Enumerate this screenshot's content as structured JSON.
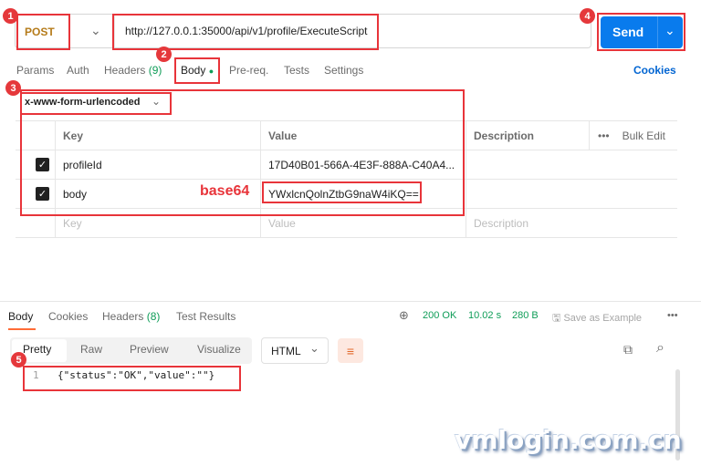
{
  "request": {
    "method": "POST",
    "url": "http://127.0.0.1:35000/api/v1/profile/ExecuteScript",
    "send_label": "Send"
  },
  "request_tabs": {
    "params": "Params",
    "auth": "Auth",
    "headers": "Headers",
    "headers_count": "(9)",
    "body": "Body",
    "prereq": "Pre-req.",
    "tests": "Tests",
    "settings": "Settings",
    "cookies": "Cookies"
  },
  "body_type": "x-www-form-urlencoded",
  "table": {
    "headers": {
      "key": "Key",
      "value": "Value",
      "description": "Description",
      "bulk_edit": "Bulk Edit"
    },
    "rows": [
      {
        "checked": true,
        "key": "profileId",
        "value": "17D40B01-566A-4E3F-888A-C40A4...",
        "description": ""
      },
      {
        "checked": true,
        "key": "body",
        "value": "YWxlcnQolnZtbG9naW4iKQ==",
        "description": ""
      }
    ],
    "placeholder": {
      "key": "Key",
      "value": "Value",
      "description": "Description"
    }
  },
  "annotation_label": "base64",
  "badges": [
    "1",
    "2",
    "3",
    "4",
    "5"
  ],
  "response": {
    "tabs": {
      "body": "Body",
      "cookies": "Cookies",
      "headers": "Headers",
      "headers_count": "(8)",
      "test_results": "Test Results"
    },
    "status": "200 OK",
    "time": "10.02 s",
    "size": "280 B",
    "save_example": "Save as Example",
    "views": {
      "pretty": "Pretty",
      "raw": "Raw",
      "preview": "Preview",
      "visualize": "Visualize"
    },
    "format": "HTML",
    "line_number": "1",
    "body_text": "{\"status\":\"OK\",\"value\":\"\"}"
  },
  "watermark": "vmlogin.com.cn",
  "colors": {
    "accent_orange": "#ff6c37",
    "send_blue": "#097bed",
    "status_green": "#0f9d58",
    "annotation_red": "#e8343a"
  }
}
